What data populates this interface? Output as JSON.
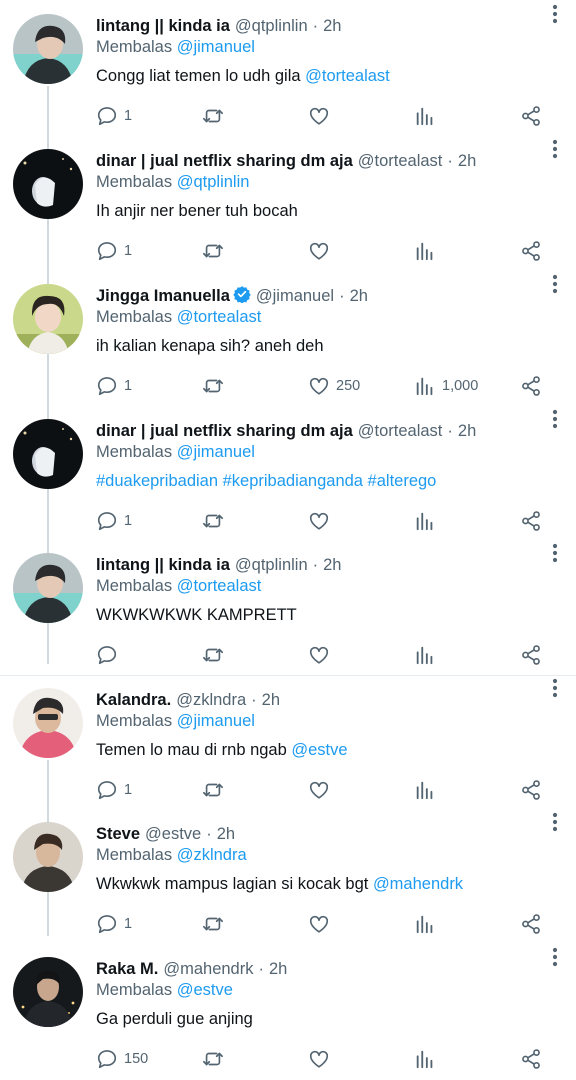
{
  "tweets": [
    {
      "name": "lintang || kinda ia",
      "handle": "@qtplinlin",
      "time": "2h",
      "verified": false,
      "reply_prefix": "Membalas",
      "reply_to": "@jimanuel",
      "text_parts": [
        {
          "t": "Congg liat temen lo udh gila ",
          "c": "plain"
        },
        {
          "t": "@tortealast",
          "c": "mention"
        }
      ],
      "replies": "1",
      "retweets": "",
      "likes": "",
      "views": "",
      "avatar_icon": "avatar-lintang"
    },
    {
      "name": "dinar | jual netflix sharing dm aja",
      "handle": "@tortealast",
      "time": "2h",
      "verified": false,
      "reply_prefix": "Membalas",
      "reply_to": "@qtplinlin",
      "text_parts": [
        {
          "t": "Ih anjir ner bener tuh bocah",
          "c": "plain"
        }
      ],
      "replies": "1",
      "retweets": "",
      "likes": "",
      "views": "",
      "avatar_icon": "avatar-dinar"
    },
    {
      "name": "Jingga Imanuella",
      "handle": "@jimanuel",
      "time": "2h",
      "verified": true,
      "reply_prefix": "Membalas",
      "reply_to": "@tortealast",
      "text_parts": [
        {
          "t": "ih kalian kenapa sih? aneh deh",
          "c": "plain"
        }
      ],
      "replies": "1",
      "retweets": "",
      "likes": "250",
      "views": "1,000",
      "avatar_icon": "avatar-jingga"
    },
    {
      "name": "dinar | jual netflix sharing dm aja",
      "handle": "@tortealast",
      "time": "2h",
      "verified": false,
      "reply_prefix": "Membalas",
      "reply_to": "@jimanuel",
      "text_parts": [
        {
          "t": "#duakepribadian #kepribadianganda #alterego",
          "c": "tag"
        }
      ],
      "replies": "1",
      "retweets": "",
      "likes": "",
      "views": "",
      "avatar_icon": "avatar-dinar"
    },
    {
      "name": "lintang || kinda ia",
      "handle": "@qtplinlin",
      "time": "2h",
      "verified": false,
      "reply_prefix": "Membalas",
      "reply_to": "@tortealast",
      "text_parts": [
        {
          "t": "WKWKWKWK KAMPRETT",
          "c": "plain"
        }
      ],
      "replies": "",
      "retweets": "",
      "likes": "",
      "views": "",
      "avatar_icon": "avatar-lintang"
    },
    {
      "name": "Kalandra.",
      "handle": "@zklndra",
      "time": "2h",
      "verified": false,
      "reply_prefix": "Membalas",
      "reply_to": "@jimanuel",
      "text_parts": [
        {
          "t": "Temen lo mau di rnb ngab ",
          "c": "plain"
        },
        {
          "t": "@estve",
          "c": "mention"
        }
      ],
      "replies": "1",
      "retweets": "",
      "likes": "",
      "views": "",
      "avatar_icon": "avatar-kalandra"
    },
    {
      "name": "Steve",
      "handle": "@estve",
      "time": "2h",
      "verified": false,
      "reply_prefix": "Membalas",
      "reply_to": "@zklndra",
      "text_parts": [
        {
          "t": "Wkwkwk mampus lagian si kocak bgt ",
          "c": "plain"
        },
        {
          "t": "@mahendrk",
          "c": "mention"
        }
      ],
      "replies": "1",
      "retweets": "",
      "likes": "",
      "views": "",
      "avatar_icon": "avatar-steve"
    },
    {
      "name": "Raka M.",
      "handle": "@mahendrk",
      "time": "2h",
      "verified": false,
      "reply_prefix": "Membalas",
      "reply_to": "@estve",
      "text_parts": [
        {
          "t": "Ga perduli gue anjing",
          "c": "plain"
        }
      ],
      "replies": "150",
      "retweets": "",
      "likes": "",
      "views": "",
      "avatar_icon": "avatar-raka"
    }
  ],
  "icons": {
    "reply": "reply-icon",
    "retweet": "retweet-icon",
    "like": "like-icon",
    "views": "views-icon",
    "share": "share-icon",
    "more": "more-icon",
    "verified": "verified-icon"
  },
  "colors": {
    "link": "#1d9bf0",
    "secondary": "#536471",
    "text": "#0f1419",
    "thread_line": "#cfd9de",
    "divider": "#e6ecf0"
  }
}
